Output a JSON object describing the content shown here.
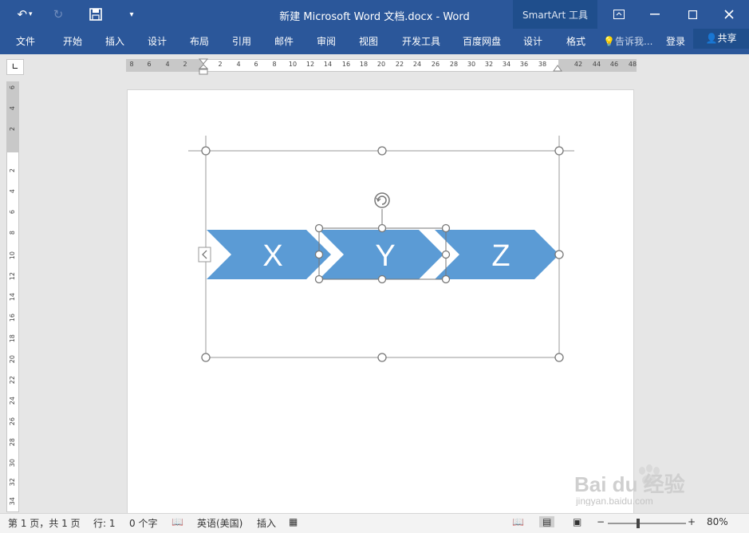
{
  "titlebar": {
    "title": "新建 Microsoft Word 文档.docx - Word",
    "context_group": "SmartArt 工具"
  },
  "ribbon": {
    "tabs": [
      "文件",
      "开始",
      "插入",
      "设计",
      "布局",
      "引用",
      "邮件",
      "审阅",
      "视图",
      "开发工具",
      "百度网盘"
    ],
    "context_tabs": [
      "设计",
      "格式"
    ],
    "tell_me": "告诉我...",
    "signin": "登录",
    "share": "共享"
  },
  "ruler": {
    "h_ticks": [
      "8",
      "6",
      "4",
      "2",
      "2",
      "4",
      "6",
      "8",
      "10",
      "12",
      "14",
      "16",
      "18",
      "20",
      "22",
      "24",
      "26",
      "28",
      "30",
      "32",
      "34",
      "36",
      "38",
      "42",
      "44",
      "46",
      "48"
    ],
    "v_ticks": [
      "6",
      "4",
      "2",
      "2",
      "4",
      "6",
      "8",
      "10",
      "12",
      "14",
      "16",
      "18",
      "20",
      "22",
      "24",
      "26",
      "28",
      "30",
      "32",
      "34"
    ]
  },
  "smartart": {
    "items": [
      "X",
      "Y",
      "Z"
    ],
    "color": "#5b9bd5"
  },
  "status": {
    "page": "第 1 页，共 1 页",
    "line": "行: 1",
    "words": "0 个字",
    "language": "英语(美国)",
    "mode": "插入",
    "zoom": "80%"
  },
  "colors": {
    "accent": "#2b579a",
    "context": "#1f4e8c"
  },
  "watermark": {
    "brand": "Bai du 经验",
    "url": "jingyan.baidu.com"
  }
}
